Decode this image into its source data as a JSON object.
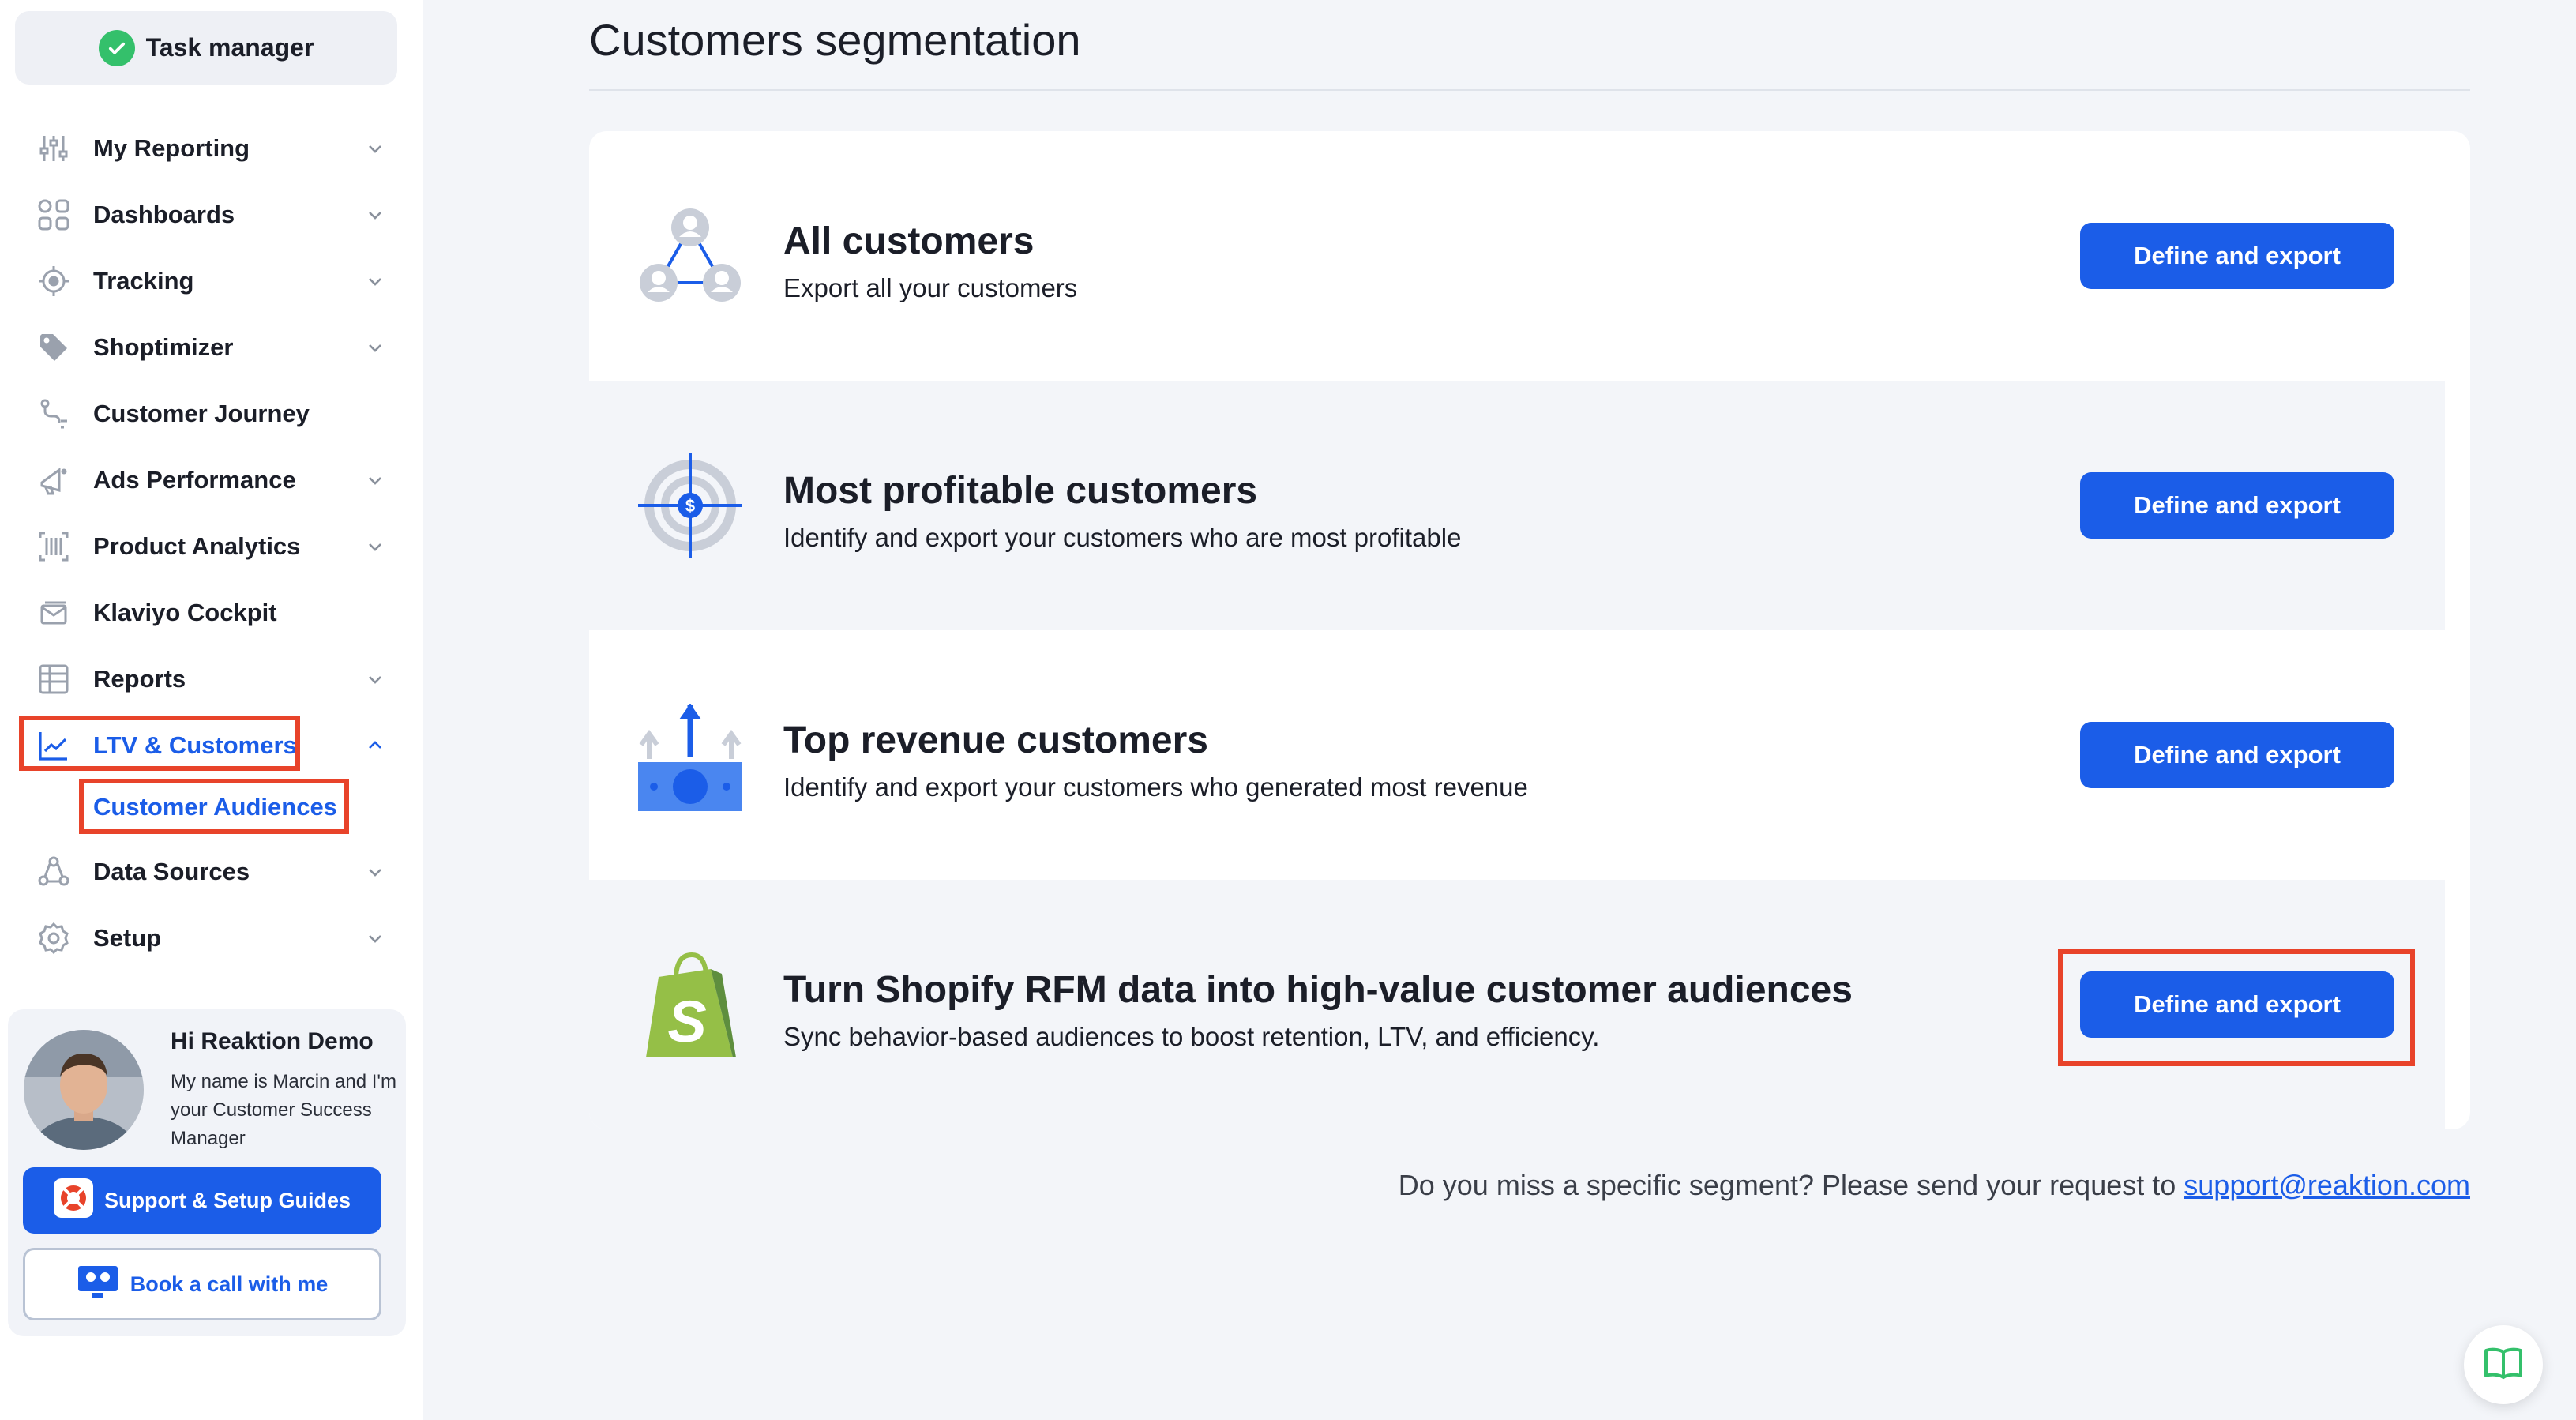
{
  "sidebar": {
    "task_manager": "Task manager",
    "items": [
      {
        "label": "My Reporting",
        "icon": "sliders-icon",
        "chevron": "down"
      },
      {
        "label": "Dashboards",
        "icon": "dashboard-grid-icon",
        "chevron": "down"
      },
      {
        "label": "Tracking",
        "icon": "crosshair-icon",
        "chevron": "down"
      },
      {
        "label": "Shoptimizer",
        "icon": "price-tag-icon",
        "chevron": "down"
      },
      {
        "label": "Customer Journey",
        "icon": "journey-path-icon",
        "chevron": ""
      },
      {
        "label": "Ads Performance",
        "icon": "megaphone-icon",
        "chevron": "down"
      },
      {
        "label": "Product Analytics",
        "icon": "barcode-icon",
        "chevron": "down"
      },
      {
        "label": "Klaviyo Cockpit",
        "icon": "email-stack-icon",
        "chevron": ""
      },
      {
        "label": "Reports",
        "icon": "table-icon",
        "chevron": "down"
      },
      {
        "label": "LTV & Customers",
        "icon": "trend-chart-icon",
        "chevron": "up",
        "active": true
      },
      {
        "label": "Data Sources",
        "icon": "data-nodes-icon",
        "chevron": "down"
      },
      {
        "label": "Setup",
        "icon": "gear-icon",
        "chevron": "down"
      }
    ],
    "sub_item": "Customer Audiences",
    "csm": {
      "greeting": "Hi Reaktion Demo",
      "message": "My name is Marcin and I'm your Customer Success Manager",
      "support_button": "Support & Setup Guides",
      "book_button": "Book a call with me"
    }
  },
  "main": {
    "title": "Customers segmentation",
    "segments": [
      {
        "title": "All customers",
        "description": "Export all your customers",
        "button": "Define and export",
        "icon": "customer-network-icon"
      },
      {
        "title": "Most profitable customers",
        "description": "Identify and export your customers who are most profitable",
        "button": "Define and export",
        "icon": "dollar-target-icon"
      },
      {
        "title": "Top revenue customers",
        "description": "Identify and export your customers who generated most revenue",
        "button": "Define and export",
        "icon": "revenue-arrows-icon"
      },
      {
        "title": "Turn Shopify RFM data into high-value customer audiences",
        "description": "Sync behavior-based audiences to boost retention, LTV, and efficiency.",
        "button": "Define and export",
        "icon": "shopify-bag-icon"
      }
    ],
    "footer_text": "Do you miss a specific segment? Please send your request to",
    "footer_link": "support@reaktion.com"
  },
  "colors": {
    "accent": "#1b5de8",
    "highlight": "#e8432a",
    "background": "#f3f5f9",
    "shopify_green": "#95bf47",
    "success_green": "#34c06b"
  }
}
